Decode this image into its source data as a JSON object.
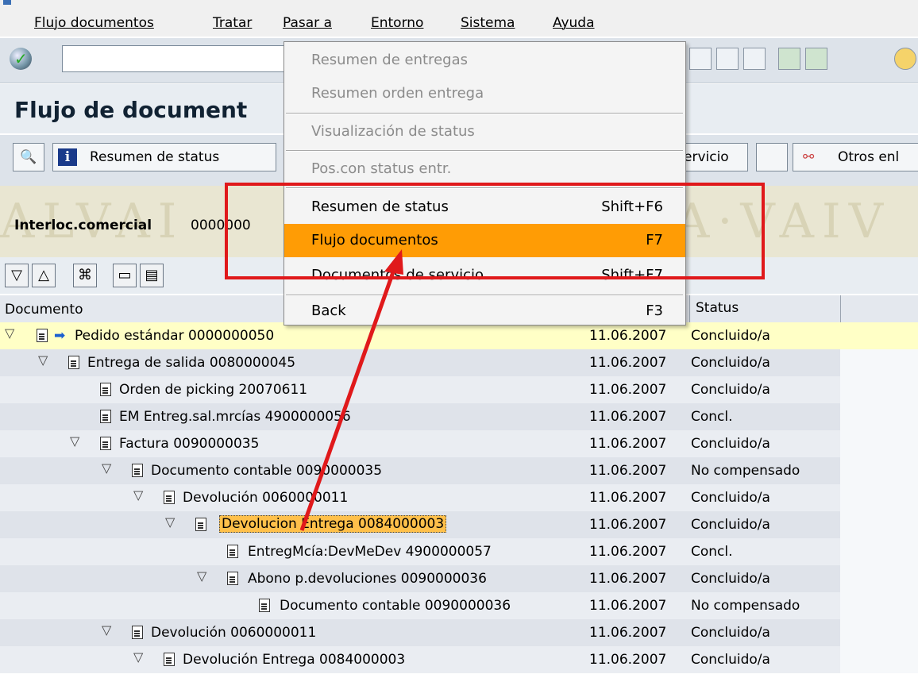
{
  "menubar": {
    "items": [
      "Flujo documentos",
      "Tratar",
      "Pasar a",
      "Entorno",
      "Sistema",
      "Ayuda"
    ]
  },
  "title": "Flujo de document",
  "app_toolbar": {
    "status_overview": "Resumen de status",
    "service_partial": "ervicio",
    "other_links": "Otros enl"
  },
  "header": {
    "partner_label": "Interloc.comercial",
    "partner_value": "0000000"
  },
  "columns": {
    "document": "Documento",
    "status": "Status"
  },
  "rows": [
    {
      "text": "Pedido estándar 0000000050",
      "date": "11.06.2007",
      "status": "Concluido/a"
    },
    {
      "text": "Entrega de salida 0080000045",
      "date": "11.06.2007",
      "status": "Concluido/a"
    },
    {
      "text": "Orden de picking 20070611",
      "date": "11.06.2007",
      "status": "Concluido/a"
    },
    {
      "text": "EM Entreg.sal.mrcías 4900000056",
      "date": "11.06.2007",
      "status": "Concl."
    },
    {
      "text": "Factura 0090000035",
      "date": "11.06.2007",
      "status": "Concluido/a"
    },
    {
      "text": "Documento contable 0090000035",
      "date": "11.06.2007",
      "status": "No compensado"
    },
    {
      "text": "Devolución 0060000011",
      "date": "11.06.2007",
      "status": "Concluido/a"
    },
    {
      "text": "Devolucion Entrega 0084000003",
      "date": "11.06.2007",
      "status": "Concluido/a"
    },
    {
      "text": "EntregMcía:DevMeDev 4900000057",
      "date": "11.06.2007",
      "status": "Concl."
    },
    {
      "text": "Abono p.devoluciones 0090000036",
      "date": "11.06.2007",
      "status": "Concluido/a"
    },
    {
      "text": "Documento contable 0090000036",
      "date": "11.06.2007",
      "status": "No compensado"
    },
    {
      "text": "Devolución 0060000011",
      "date": "11.06.2007",
      "status": "Concluido/a"
    },
    {
      "text": "Devolución Entrega 0084000003",
      "date": "11.06.2007",
      "status": "Concluido/a"
    }
  ],
  "dropdown": {
    "items": [
      {
        "label": "Resumen de entregas",
        "key": ""
      },
      {
        "label": "Resumen orden entrega",
        "key": ""
      },
      {
        "label": "Visualización de status",
        "key": ""
      },
      {
        "label": "Pos.con status entr.",
        "key": ""
      },
      {
        "label": "Resumen de status",
        "key": "Shift+F6"
      },
      {
        "label": "Flujo documentos",
        "key": "F7"
      },
      {
        "label": "Documentos de servicio",
        "key": "Shift+F7"
      },
      {
        "label": "Back",
        "key": "F3"
      }
    ]
  },
  "colors": {
    "menu_highlight": "#ff9c05",
    "annotation_red": "#e0191b"
  }
}
